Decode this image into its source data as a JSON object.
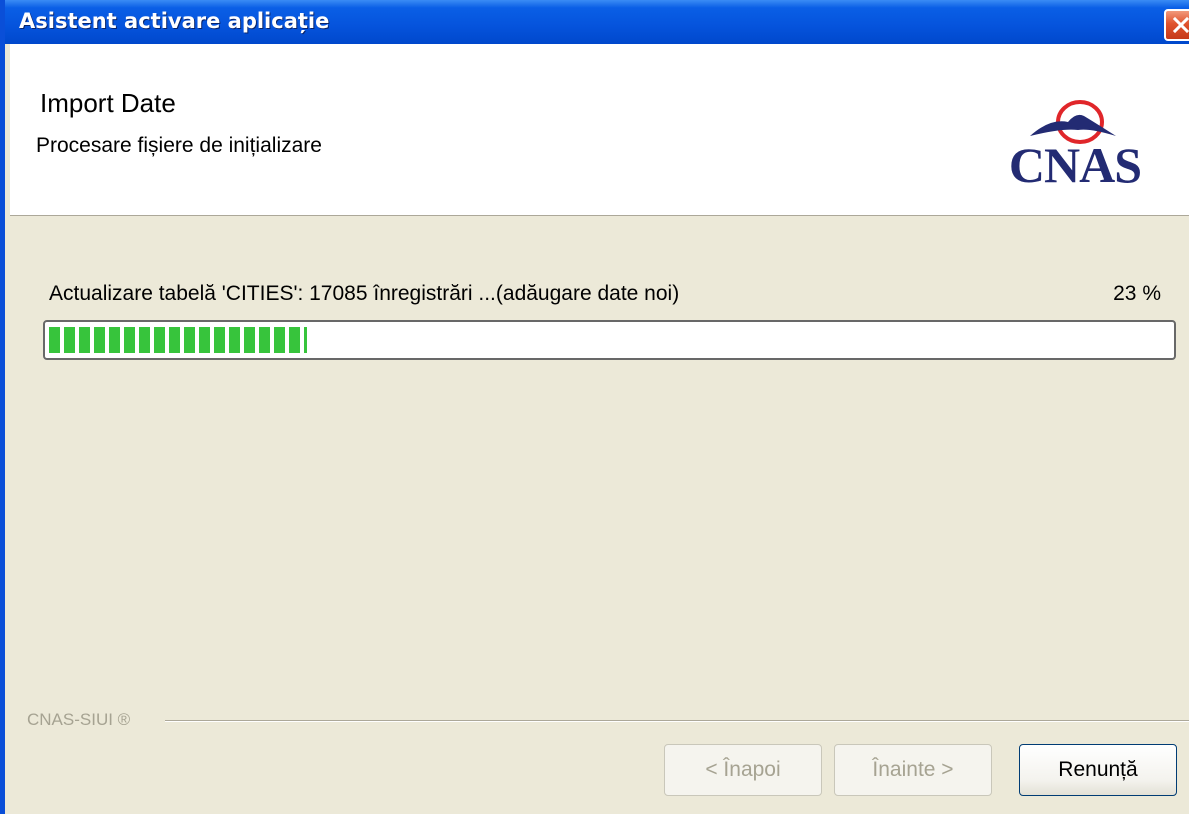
{
  "window": {
    "title": "Asistent activare aplicație"
  },
  "header": {
    "title": "Import Date",
    "subtitle": "Procesare fișiere de inițializare",
    "logo_text": "CNAS"
  },
  "progress": {
    "status": "Actualizare tabelă 'CITIES': 17085 înregistrări ...(adăugare date noi)",
    "percent_label": "23 %",
    "value": 0.23
  },
  "footer": {
    "brand": "CNAS-SIUI ®",
    "back_label": "< Înapoi",
    "next_label": "Înainte >",
    "cancel_label": "Renunță"
  },
  "colors": {
    "titlebar": "#0553dc",
    "progress_fill": "#37c43c",
    "logo": "#232b73"
  }
}
